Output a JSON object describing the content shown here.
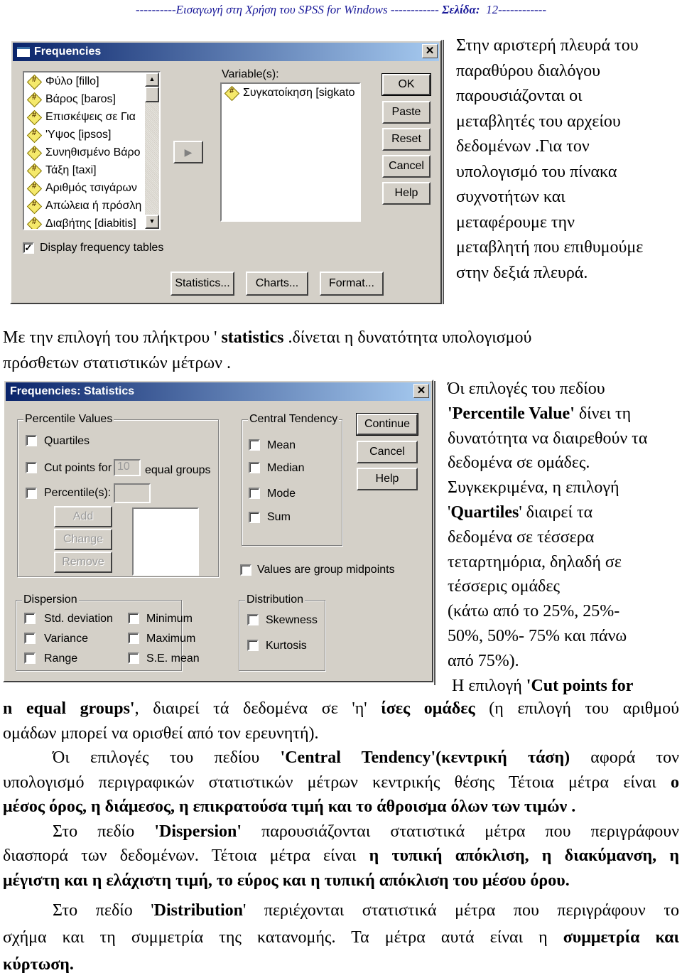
{
  "header": {
    "prefix": "----------Εισαγωγή στη Χρήση του SPSS for Windows ------------ ",
    "page_label": "Σελίδα:",
    "page_number": "12",
    "suffix": "------------"
  },
  "frequencies_dialog": {
    "title": "Frequencies",
    "source_variables": [
      "Φύλο [fillo]",
      "Βάρος [baros]",
      "Επισκέψεις σε Για",
      "'Υψος [ipsos]",
      "Συνηθισμένο Βάρο",
      "Τάξη [taxi]",
      "Αριθμός τσιγάρων",
      "Απώλεια ή πρόσλη",
      "Διαβήτης [diabitis]"
    ],
    "variables_label": "Variable(s):",
    "selected_variables": [
      "Συγκατοίκηση [sigkato"
    ],
    "variable_icon": "#",
    "buttons": {
      "ok": "OK",
      "paste": "Paste",
      "reset": "Reset",
      "cancel": "Cancel",
      "help": "Help"
    },
    "display_tables_label": "Display frequency tables",
    "display_tables_checked": true,
    "bottom_buttons": {
      "statistics": "Statistics...",
      "charts": "Charts...",
      "format": "Format..."
    }
  },
  "intro_text": [
    "Στην αριστερή πλευρά του",
    "παραθύρου διαλόγου",
    "παρουσιάζονται οι",
    "μεταβλητές του αρχείου",
    "δεδομένων .Για τον",
    "υπολογισμό του πίνακα",
    "συχνοτήτων και",
    "μεταφέρουμε την",
    "μεταβλητή που επιθυμούμε",
    "στην δεξιά πλευρά."
  ],
  "statistics_intro": {
    "line1_a": "Με την επιλογή του πλήκτρου '",
    "line1_b": " statistics",
    "line1_c": " .δίνεται η δυνατότητα υπολογισμού",
    "line2": "πρόσθετων στατιστικών μέτρων ."
  },
  "stats_dialog": {
    "title": "Frequencies: Statistics",
    "percentile": {
      "legend": "Percentile Values",
      "quartiles": "Quartiles",
      "cut_points_for": "Cut points for",
      "cut_points_value": "10",
      "equal_groups": "equal groups",
      "percentiles": "Percentile(s):",
      "add": "Add",
      "change": "Change",
      "remove": "Remove"
    },
    "central": {
      "legend": "Central Tendency",
      "mean": "Mean",
      "median": "Median",
      "mode": "Mode",
      "sum": "Sum"
    },
    "buttons": {
      "continue": "Continue",
      "cancel": "Cancel",
      "help": "Help"
    },
    "group_midpoints": "Values are group midpoints",
    "dispersion": {
      "legend": "Dispersion",
      "std_deviation": "Std. deviation",
      "variance": "Variance",
      "range": "Range",
      "minimum": "Minimum",
      "maximum": "Maximum",
      "se_mean": "S.E. mean"
    },
    "distribution": {
      "legend": "Distribution",
      "skewness": "Skewness",
      "kurtosis": "Kurtosis"
    }
  },
  "percentile_text": {
    "l1": "Όι επιλογές του πεδίου",
    "l2_bold": "'Percentile Value'",
    "l2_rest": " δίνει τη",
    "l3": "δυνατότητα να διαιρεθούν τα",
    "l4": "δεδομένα σε ομάδες.",
    "l5": "Συγκεκριμένα, η επιλογή",
    "l6_q1": "'",
    "l6_bold": "Quartiles",
    "l6_rest": "' διαιρεί τα",
    "l7": "δεδομένα σε τέσσερα",
    "l8": "τεταρτημόρια, δηλαδή σε",
    "l9": "τέσσερις ομάδες",
    "l10": "(κάτω από το 25%, 25%-",
    "l11": "50%, 50%- 75% και πάνω",
    "l12": "από 75%).",
    "l13_a": " Η επιλογή ",
    "l13_bold": "'Cut points for"
  },
  "body_paragraphs": {
    "cut_line1_bold": "n equal groups'",
    "cut_line1_a": ", διαιρεί τά δεδομένα σε 'η' ",
    "cut_line1_bold2": "ίσες ομάδες",
    "cut_line1_b": " (η επιλογή του αριθμού",
    "cut_line2": "ομάδων μπορεί να ορισθεί από τον ερευνητή).",
    "central_a": "Όι επιλογές του πεδίου ",
    "central_bold": "'Central Tendency'(κεντρική τάση)",
    "central_b": " αφορά τον",
    "central_line2_a": "υπολογισμό περιγραφικών στατιστικών μέτρων κεντρικής θέσης Τέτοια μέτρα είναι ",
    "central_line2_bold": "ο",
    "central_line3_bold": "μέσος όρος, η διάμεσος, η επικρατούσα τιμή και το άθροισμα όλων των τιμών .",
    "disp_a": "Στο πεδίο ",
    "disp_bold": "'Dispersion'",
    "disp_b": " παρουσιάζονται στατιστικά μέτρα που περιγράφουν",
    "disp_line2_a": "διασπορά των δεδομένων. Τέτοια μέτρα είναι ",
    "disp_line2_bold": "η τυπική απόκλιση, η διακύμανση, η",
    "disp_line3_bold": "μέγιστη και η ελάχιστη τιμή, το εύρος και η τυπική απόκλιση του μέσου όρου.",
    "dist_a": "Στο πεδίο '",
    "dist_bold": "Distribution",
    "dist_b": "' περιέχονται στατιστικά μέτρα που περιγράφουν το",
    "dist_line2_a": "σχήμα και τη συμμετρία της κατανομής. Τα μέτρα αυτά είναι η ",
    "dist_line2_bold": "συμμετρία και",
    "dist_line3_bold": "κύρτωση."
  }
}
